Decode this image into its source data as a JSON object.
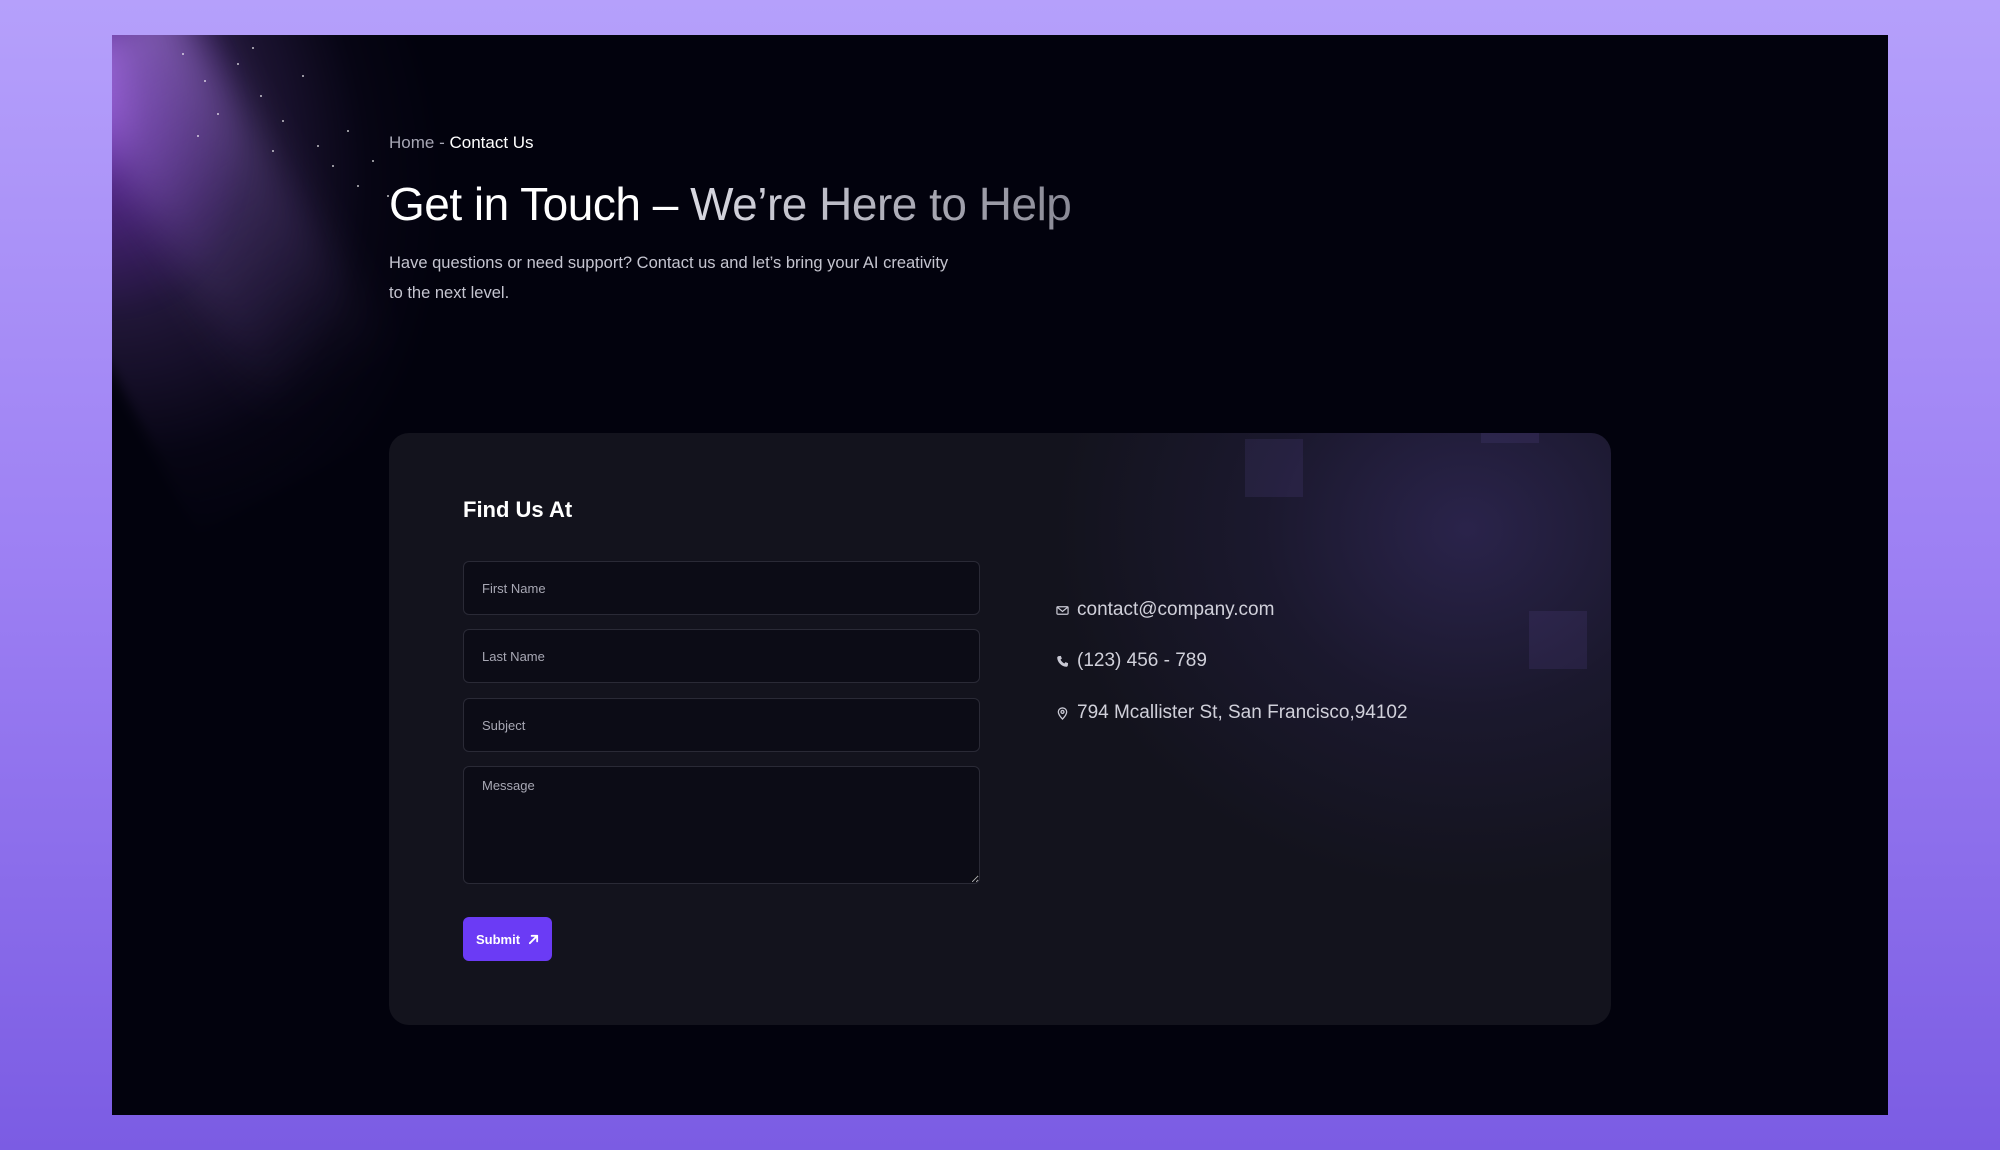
{
  "breadcrumb": {
    "home": "Home",
    "separator": " - ",
    "current": "Contact Us"
  },
  "hero": {
    "title_part1": "Get in Touch – ",
    "title_part2": "We’re Here to Help",
    "subtitle": "Have questions or need support? Contact us and let’s bring your AI creativity to the next level."
  },
  "contact_card": {
    "title": "Find Us At",
    "form": {
      "first_name_placeholder": "First Name",
      "last_name_placeholder": "Last Name",
      "subject_placeholder": "Subject",
      "message_placeholder": "Message",
      "submit_label": "Submit"
    },
    "info": {
      "email": "contact@company.com",
      "phone": "(123) 456 - 789",
      "address": "794 Mcallister St, San Francisco,94102"
    }
  },
  "icons": {
    "email": "mail-icon",
    "phone": "phone-icon",
    "address": "map-pin-icon",
    "submit": "arrow-up-right-icon"
  },
  "colors": {
    "accent": "#6b3bf5",
    "page_background": "#02020d",
    "card_background": "#13131d",
    "outer_gradient_top": "#b5a0fb",
    "outer_gradient_bottom": "#7b5ce3"
  }
}
